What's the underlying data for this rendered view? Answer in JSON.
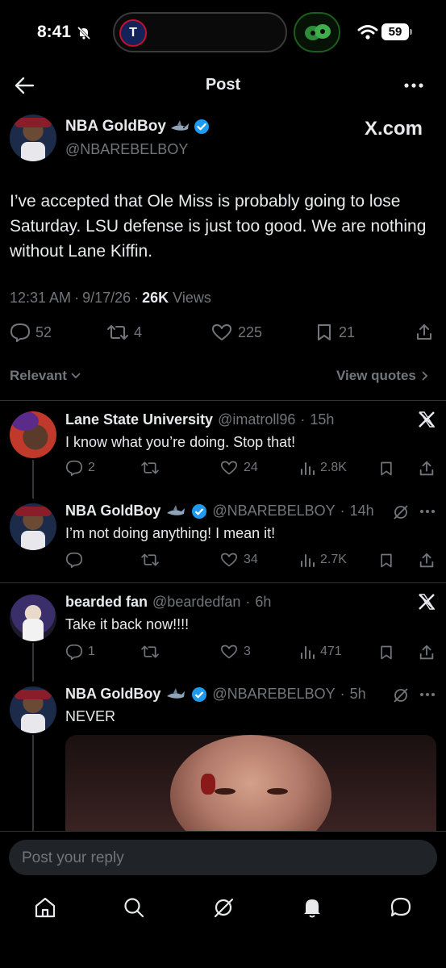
{
  "status_bar": {
    "time": "8:41",
    "battery": "59",
    "team_badge": "T"
  },
  "header": {
    "title": "Post"
  },
  "main_post": {
    "author_name": "NBA GoldBoy",
    "author_handle": "@NBAREBELBOY",
    "source_label": "X.com",
    "text": "I’ve accepted that Ole Miss is probably going to lose Saturday. LSU defense is just too good. We are nothing without Lane Kiffin.",
    "time": "12:31 AM",
    "date": "9/17/26",
    "views_count": "26K",
    "views_label": "Views",
    "replies": "52",
    "reposts": "4",
    "likes": "225",
    "bookmarks": "21"
  },
  "sort": {
    "relevant_label": "Relevant",
    "view_quotes_label": "View quotes"
  },
  "replies": [
    {
      "name": "Lane State University",
      "handle": "@imatroll96",
      "time": "15h",
      "text": "I know what you’re doing. Stop that!",
      "replies": "2",
      "reposts": "",
      "likes": "24",
      "views": "2.8K"
    },
    {
      "name": "NBA GoldBoy",
      "handle": "@NBAREBELBOY",
      "time": "14h",
      "text": "I’m not doing anything! I mean it!",
      "replies": "",
      "reposts": "",
      "likes": "34",
      "views": "2.7K"
    },
    {
      "name": "bearded fan",
      "handle": "@beardedfan",
      "time": "6h",
      "text": "Take it back now!!!!",
      "replies": "1",
      "reposts": "",
      "likes": "3",
      "views": "471"
    },
    {
      "name": "NBA GoldBoy",
      "handle": "@NBAREBELBOY",
      "time": "5h",
      "text": "NEVER"
    }
  ],
  "composer": {
    "placeholder": "Post your reply"
  },
  "colors": {
    "accent": "#1d9bf0",
    "background": "#000000",
    "text": "#e7e9ea",
    "muted": "#71767b"
  }
}
